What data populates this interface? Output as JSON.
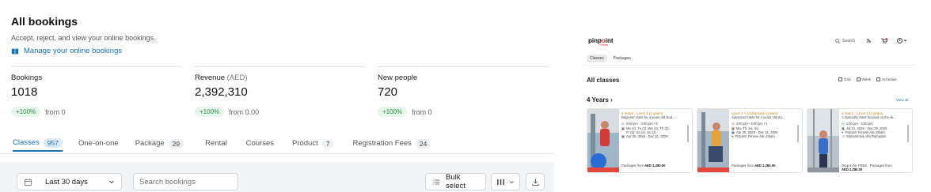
{
  "header": {
    "title": "All bookings",
    "subtitle": "Accept, reject, and view your online bookings.",
    "manage_link": "Manage your online bookings"
  },
  "stats": [
    {
      "label": "Bookings",
      "unit": "",
      "value": "1018",
      "change": "+100%",
      "from": "from 0"
    },
    {
      "label": "Revenue",
      "unit": "(AED)",
      "value": "2,392,310",
      "change": "+100%",
      "from": "from 0.00"
    },
    {
      "label": "New people",
      "unit": "",
      "value": "720",
      "change": "+100%",
      "from": "from 0"
    }
  ],
  "tabs": [
    {
      "label": "Classes",
      "count": "957",
      "active": true
    },
    {
      "label": "One-on-one",
      "count": "",
      "active": false
    },
    {
      "label": "Package",
      "count": "29",
      "active": false
    },
    {
      "label": "Rental",
      "count": "",
      "active": false
    },
    {
      "label": "Courses",
      "count": "",
      "active": false
    },
    {
      "label": "Product",
      "count": "7",
      "active": false
    },
    {
      "label": "Registration Fees",
      "count": "24",
      "active": false
    }
  ],
  "toolbar": {
    "date_range": "Last 30 days",
    "search_placeholder": "Search bookings",
    "bulk_select": "Bulk select"
  },
  "colors": {
    "accent": "#1a73b8",
    "positive_bg": "#e6f6ea",
    "positive_text": "#2e8b4a",
    "brand_red": "#e03131",
    "class_title": "#c88419"
  },
  "preview": {
    "logo": {
      "pre": "pinp",
      "o": "o",
      "post": "int",
      "tagline": "Fitness"
    },
    "search": "Search",
    "tabs": [
      "Classes",
      "Packages"
    ],
    "all_classes": "All classes",
    "views": [
      "Grid",
      "Week",
      "Schedule"
    ],
    "section": "4 Years",
    "view_all": "View all",
    "cards": [
      {
        "title": "4 Years - Level 1 (4 years)",
        "desc": "Beginner class for 4 years old stud...",
        "lines": [
          "3:00 pm - 4:00 pm +3",
          "Mo (2), Tu (2), We (2), Th (2),",
          "Fr (2), Sa (2), Su (2)",
          "Apr 20, 2026 - Dec 31, 2026"
        ],
        "foot_pre": "Packages from ",
        "foot_price": "AED 2,280.00"
      },
      {
        "title": "Level 1 + (Advanced 4 years)",
        "desc": "Advanced class for 4 years old stu...",
        "lines": [
          "4:00 pm - 5:00 pm +1",
          "Mo, Th, Sa, Su",
          "Apr 20, 2026 - Dec 31, 2026",
          "Pinpoint Fitness Abu Dhabi"
        ],
        "foot_pre": "Packages from ",
        "foot_price": "AED 2,280.00"
      },
      {
        "title": "4 Years - Level 1 (4 years)",
        "desc": "A Specialty class focused on the sk...",
        "lines": [
          "4:00 pm - 5:00 pm",
          "Jul 21, 2026 - Dec 29, 2026",
          "Pinpoint Fitness Abu Dhabi",
          "Mohammed Abu Ramadan"
        ],
        "foot_pre": "Drop-in for FREE · Packages from",
        "foot_price": "AED 2,280.00"
      }
    ]
  }
}
